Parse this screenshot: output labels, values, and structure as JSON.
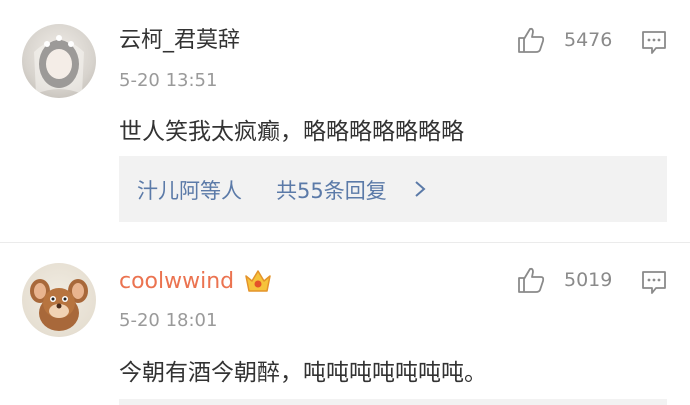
{
  "comments": [
    {
      "username": "云柯_君莫辞",
      "time": "5-20 13:51",
      "text": "世人笑我太疯癫，略略略略略略略",
      "likes": "5476",
      "replies": {
        "users": "汁儿阿等人",
        "count_label": "共55条回复"
      },
      "icons": {
        "like": "thumbs-up-icon",
        "reply": "comment-icon",
        "chevron": "chevron-right-icon"
      }
    },
    {
      "username": "coolwwind",
      "time": "5-20 18:01",
      "text": "今朝有酒今朝醉，吨吨吨吨吨吨吨。",
      "likes": "5019",
      "badge": "vip-crown-icon",
      "icons": {
        "like": "thumbs-up-icon",
        "reply": "comment-icon"
      }
    }
  ],
  "colors": {
    "username_default": "#333333",
    "username_vip": "#eb7350",
    "link_blue": "#5b7aa8",
    "muted": "#9a9a9a",
    "reply_bg": "#f2f2f2"
  }
}
